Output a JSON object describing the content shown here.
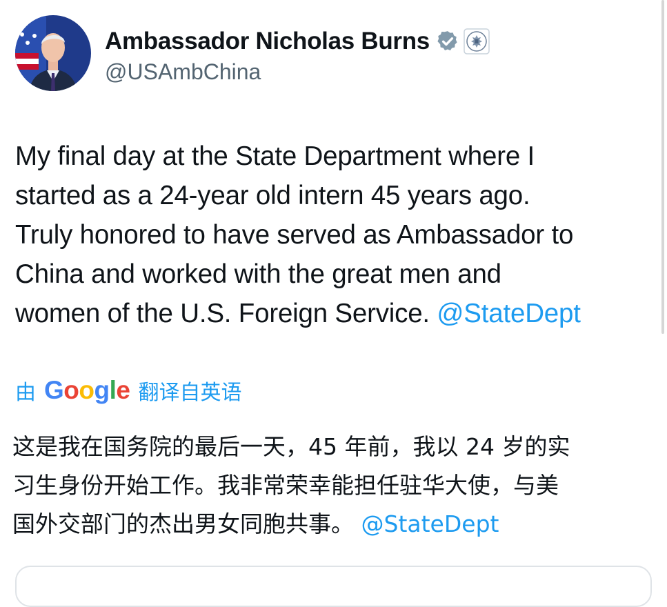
{
  "profile": {
    "display_name": "Ambassador Nicholas Burns",
    "handle": "@USAmbChina",
    "avatar": "avatar-photo",
    "badges": [
      "verified-badge-icon",
      "state-department-seal-icon"
    ]
  },
  "tweet": {
    "lines": [
      "My final day at the State Department where I",
      "started as a 24-year old intern 45 years ago.",
      "Truly honored to have served as Ambassador to",
      "China and worked with the great men and",
      "women of the U.S. Foreign Service. "
    ],
    "mention": "@StateDept"
  },
  "translation": {
    "prefix": "由",
    "provider": "Google",
    "suffix": "翻译自英语",
    "lines": [
      "这是我在国务院的最后一天，45 年前，我以 24 岁的实",
      "习生身份开始工作。我非常荣幸能担任驻华大使，与美",
      "国外交部门的杰出男女同胞共事。 "
    ],
    "mention": "@StateDept"
  },
  "colors": {
    "accent": "#1d9bf0",
    "text": "#0f1419",
    "muted": "#536471"
  }
}
